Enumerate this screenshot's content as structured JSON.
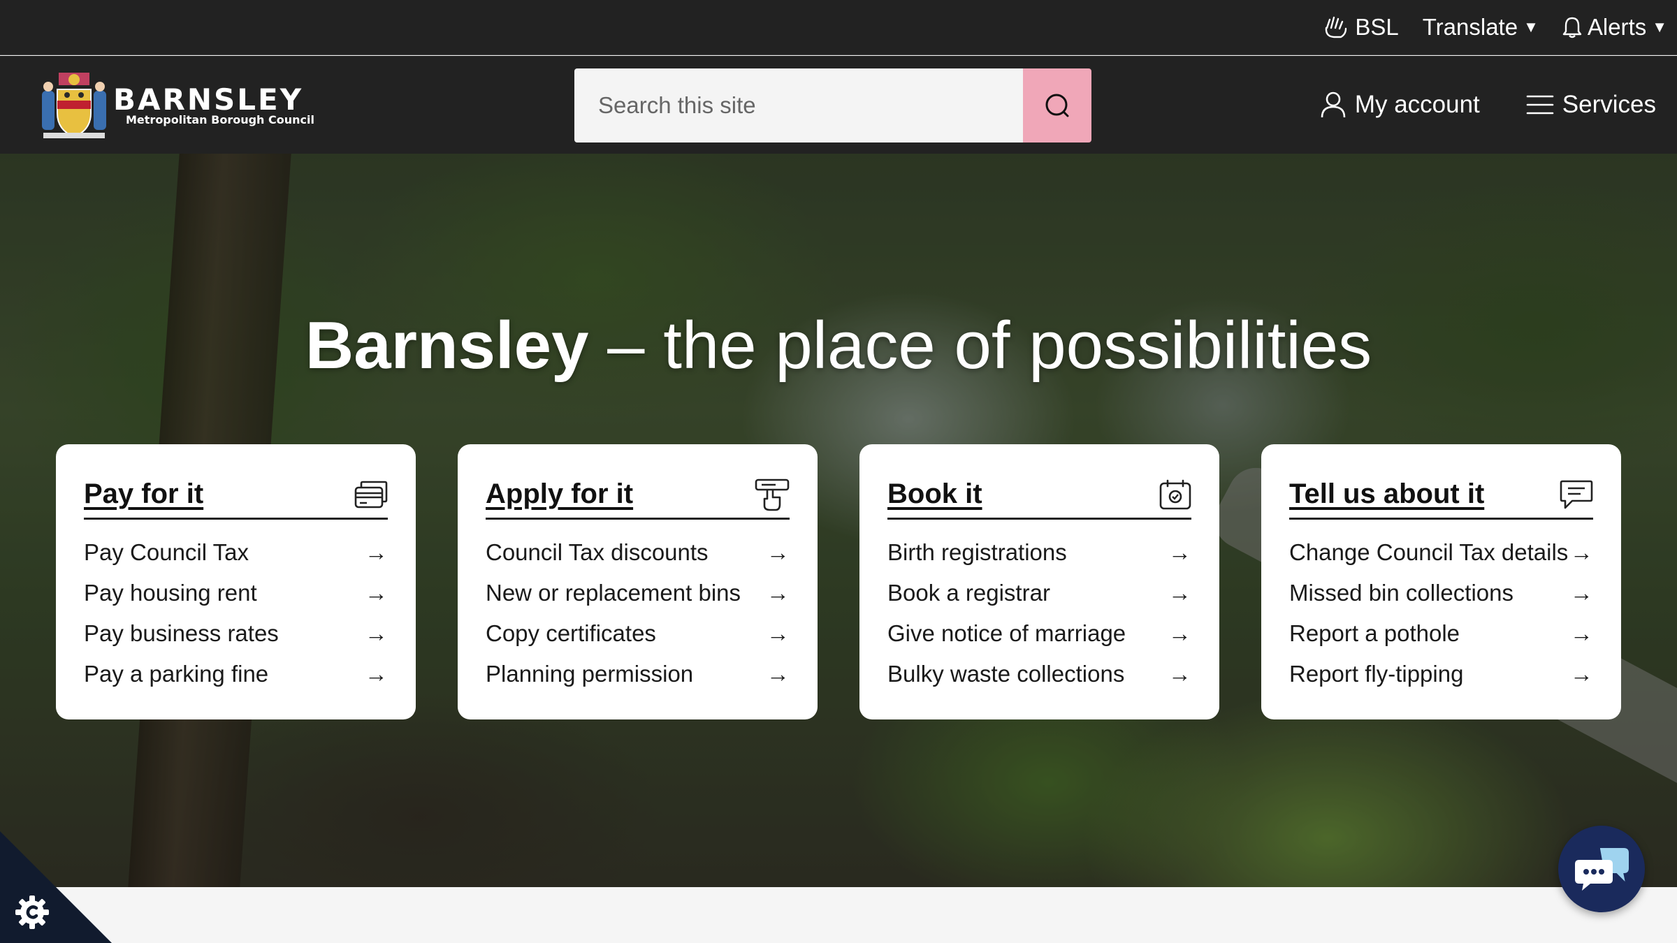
{
  "utility": {
    "bsl_label": "BSL",
    "translate_label": "Translate",
    "alerts_label": "Alerts"
  },
  "header": {
    "logo_title": "BARNSLEY",
    "logo_subtitle": "Metropolitan Borough Council",
    "search_placeholder": "Search this site",
    "my_account_label": "My account",
    "services_label": "Services"
  },
  "hero": {
    "title_strong": "Barnsley",
    "title_light": " – the place of possibilities"
  },
  "cards": [
    {
      "title": "Pay for it",
      "icon": "card-payment-icon",
      "items": [
        "Pay Council Tax",
        "Pay housing rent",
        "Pay business rates",
        "Pay a parking fine"
      ]
    },
    {
      "title": "Apply for it",
      "icon": "form-hand-icon",
      "items": [
        "Council Tax discounts",
        "New or replacement bins",
        "Copy certificates",
        "Planning permission"
      ]
    },
    {
      "title": "Book it",
      "icon": "calendar-check-icon",
      "items": [
        "Birth registrations",
        "Book a registrar",
        "Give notice of marriage",
        "Bulky waste collections"
      ]
    },
    {
      "title": "Tell us about it",
      "icon": "speech-bubble-icon",
      "items": [
        "Change Council Tax details",
        "Missed bin collections",
        "Report a pothole",
        "Report fly-tipping"
      ]
    }
  ],
  "colors": {
    "header_bg": "#222222",
    "search_button": "#f0a7b8",
    "chat_button": "#1a2a5c",
    "cookie_corner": "#111b2e"
  }
}
